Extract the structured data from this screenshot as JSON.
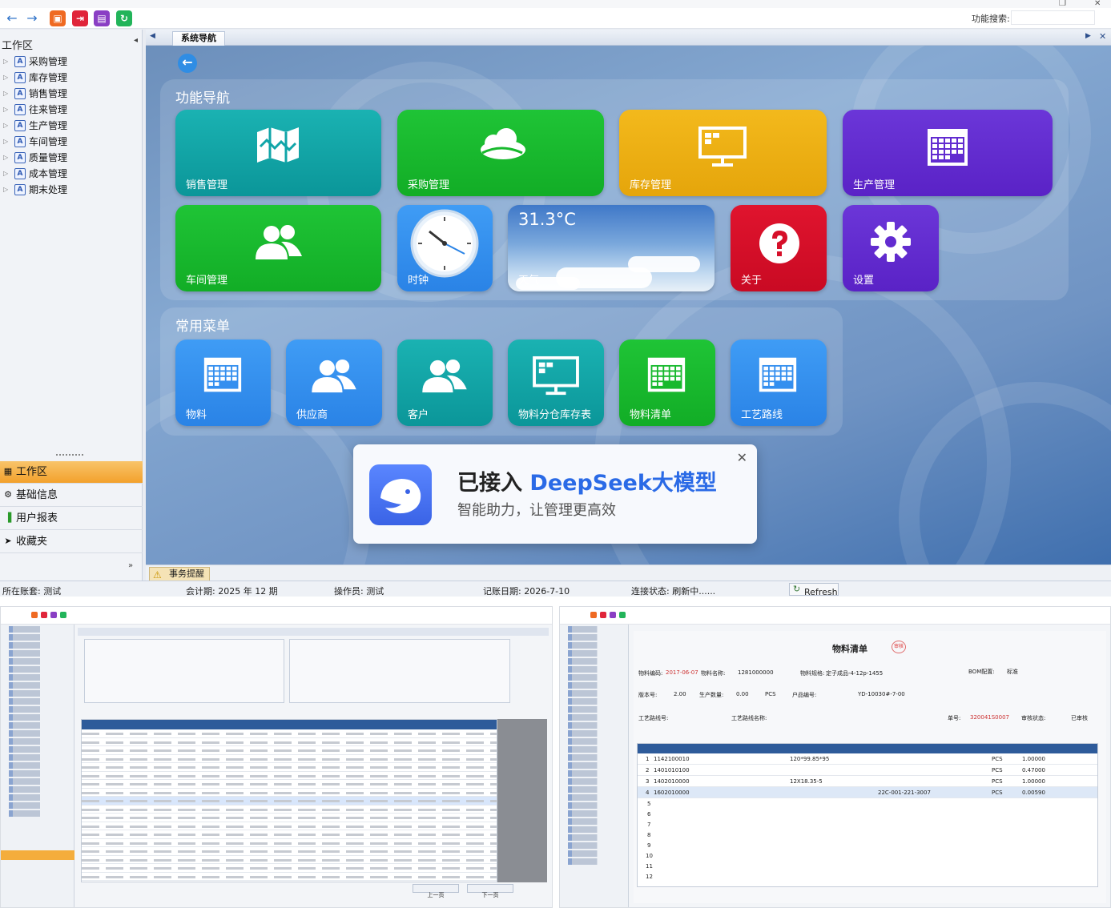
{
  "app": {
    "title_blurred": "",
    "search_label": "功能搜索:"
  },
  "sidebar": {
    "header": "工作区",
    "tree_items": [
      {
        "label": "采购管理"
      },
      {
        "label": "库存管理"
      },
      {
        "label": "销售管理"
      },
      {
        "label": "往来管理"
      },
      {
        "label": "生产管理"
      },
      {
        "label": "车间管理"
      },
      {
        "label": "质量管理"
      },
      {
        "label": "成本管理"
      },
      {
        "label": "期末处理"
      }
    ],
    "accordion": [
      {
        "label": "工作区",
        "active": true
      },
      {
        "label": "基础信息",
        "active": false
      },
      {
        "label": "用户报表",
        "active": false
      },
      {
        "label": "收藏夹",
        "active": false
      }
    ]
  },
  "tabs": {
    "active": "系统导航"
  },
  "main": {
    "section1_title": "功能导航",
    "section2_title": "常用菜单",
    "nav_tiles": [
      {
        "label": "销售管理",
        "color": "#10a5a8",
        "icon": "map-icon"
      },
      {
        "label": "采购管理",
        "color": "#17b92d",
        "icon": "cloud-icon"
      },
      {
        "label": "库存管理",
        "color": "#edae12",
        "icon": "monitor-icon"
      },
      {
        "label": "生产管理",
        "color": "#622bd0",
        "icon": "calendar-icon"
      },
      {
        "label": "车间管理",
        "color": "#17b92d",
        "icon": "users-icon"
      },
      {
        "label": "时钟",
        "color": "#348fef",
        "icon": "clock-icon"
      },
      {
        "label": "天气",
        "temperature": "31.3°C",
        "icon": "weather-icon"
      },
      {
        "label": "关于",
        "color": "#d60f29",
        "icon": "help-icon"
      },
      {
        "label": "设置",
        "color": "#622bd0",
        "icon": "gear-icon"
      }
    ],
    "menu_tiles": [
      {
        "label": "物料",
        "color": "#348fef",
        "icon": "calendar-icon"
      },
      {
        "label": "供应商",
        "color": "#348fef",
        "icon": "users-icon"
      },
      {
        "label": "客户",
        "color": "#10a5a8",
        "icon": "users-icon"
      },
      {
        "label": "物料分仓库存表",
        "color": "#10a5a8",
        "icon": "monitor-icon"
      },
      {
        "label": "物料清单",
        "color": "#17b92d",
        "icon": "calendar-icon"
      },
      {
        "label": "工艺路线",
        "color": "#348fef",
        "icon": "calendar-icon"
      }
    ]
  },
  "deepseek": {
    "title_prefix": "已接入 ",
    "title_brand": "DeepSeek大模型",
    "subtitle": "智能助力，让管理更高效",
    "close": "✕"
  },
  "notebar": {
    "tab": "事务提醒"
  },
  "statusbar": {
    "account": "所在账套: 测试",
    "period": "会计期: 2025 年 12 期",
    "operator": "操作员: 测试",
    "date": "记账日期: 2026-7-10",
    "connection": "连接状态: 刷新中......",
    "refresh": "Refresh"
  },
  "thumbnails": {
    "left": {
      "prev_button": "上一页",
      "next_button": "下一页"
    },
    "right": {
      "title": "物料清单",
      "stamp": "审核",
      "fields": {
        "material_code_label": "物料编码:",
        "material_code_value": "2017-06-07",
        "material_name_label": "物料名称:",
        "material_name_value": "1281000000",
        "material_spec_label": "物料规格:",
        "material_spec_value": "定子成品-4-12p-1455",
        "bom_label": "BOM配置:",
        "bom_value": "标准",
        "version_label": "版本号:",
        "version_value": "2.00",
        "qty_label": "生产数量:",
        "qty_value": "0.00",
        "unit_value": "PCS",
        "order_label": "户品编号:",
        "order_value": "YD-10030#-7-00",
        "route_label": "工艺路线号:",
        "route_name_label": "工艺路线名称:",
        "status_label": "审核状态:",
        "status_value": "已审核",
        "code_label": "单号:",
        "code_value": "320041S0007"
      },
      "rows": [
        {
          "no": "1",
          "code": "1142100010",
          "spec": "120*99.85*95",
          "unit": "PCS",
          "qty": "1.00000"
        },
        {
          "no": "2",
          "code": "1401010100",
          "spec": "",
          "unit": "PCS",
          "qty": "0.47000"
        },
        {
          "no": "3",
          "code": "1402010000",
          "spec": "12X18.35-5",
          "unit": "PCS",
          "qty": "1.00000"
        },
        {
          "no": "4",
          "code": "1602010000",
          "spec": "22C-001-221-3007",
          "unit": "PCS",
          "qty": "0.00590"
        }
      ],
      "row_numbers": [
        "5",
        "6",
        "7",
        "8",
        "9",
        "10",
        "11",
        "12"
      ]
    }
  }
}
